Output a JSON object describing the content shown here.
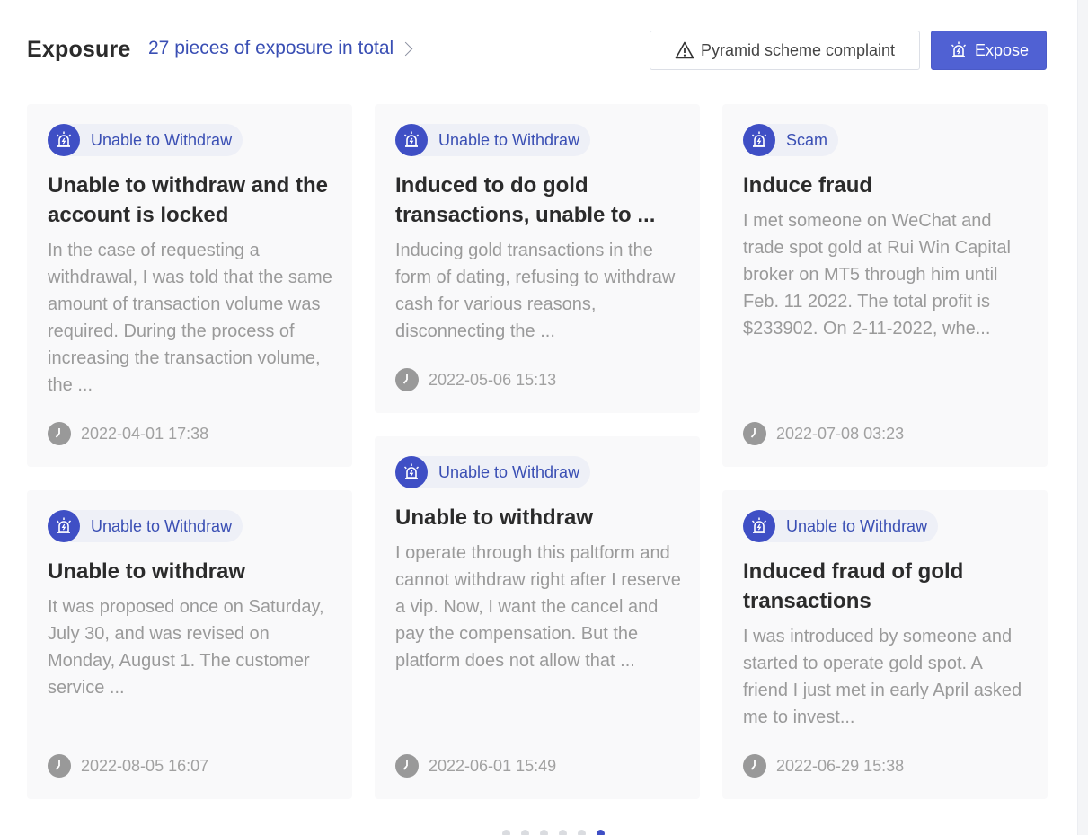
{
  "header": {
    "title": "Exposure",
    "total_link": "27 pieces of exposure in total",
    "complaint_label": "Pyramid scheme complaint",
    "expose_label": "Expose"
  },
  "cards": [
    {
      "tag": "Unable to Withdraw",
      "title": "Unable to withdraw and the account is locked",
      "excerpt": "In the case of requesting a withdrawal, I was told that the same amount of transaction volume was required. During the process of increasing the transaction volume, the ...",
      "time": "2022-04-01 17:38"
    },
    {
      "tag": "Unable to Withdraw",
      "title": "Induced to do gold transactions, unable to ...",
      "excerpt": "Inducing gold transactions in the form of dating, refusing to withdraw cash for various reasons, disconnecting the ...",
      "time": "2022-05-06 15:13"
    },
    {
      "tag": "Scam",
      "title": "Induce fraud",
      "excerpt": "I met someone on WeChat and trade spot gold at Rui Win Capital broker on MT5 through him until Feb. 11 2022. The total profit is $233902. On 2-11-2022, whe...",
      "time": "2022-07-08 03:23"
    },
    {
      "tag": "Unable to Withdraw",
      "title": "Unable to withdraw",
      "excerpt": "It was proposed once on Saturday, July 30, and was revised on Monday, August 1. The customer service ...",
      "time": "2022-08-05 16:07"
    },
    {
      "tag": "Unable to Withdraw",
      "title": "Unable to withdraw",
      "excerpt": "I operate through this paltform and cannot withdraw right after I reserve a vip. Now, I want the cancel and pay the compensation. But the platform does not allow that ...",
      "time": "2022-06-01 15:49"
    },
    {
      "tag": "Unable to Withdraw",
      "title": "Induced fraud of gold transactions",
      "excerpt": "I was introduced by someone and started to operate gold spot. A friend I just met in early April asked me to invest...",
      "time": "2022-06-29 15:38"
    }
  ],
  "pagination": {
    "pages": 6,
    "current": 6
  },
  "colors": {
    "accent": "#4f5fd2",
    "tag_text": "#3a4fb4",
    "excerpt": "#9a9a9a"
  },
  "icons": {
    "tag": "alarm-siren-icon",
    "time": "clock-icon",
    "warning": "warning-triangle-icon",
    "expose": "alarm-siren-icon",
    "more": "chevron-right-icon"
  }
}
